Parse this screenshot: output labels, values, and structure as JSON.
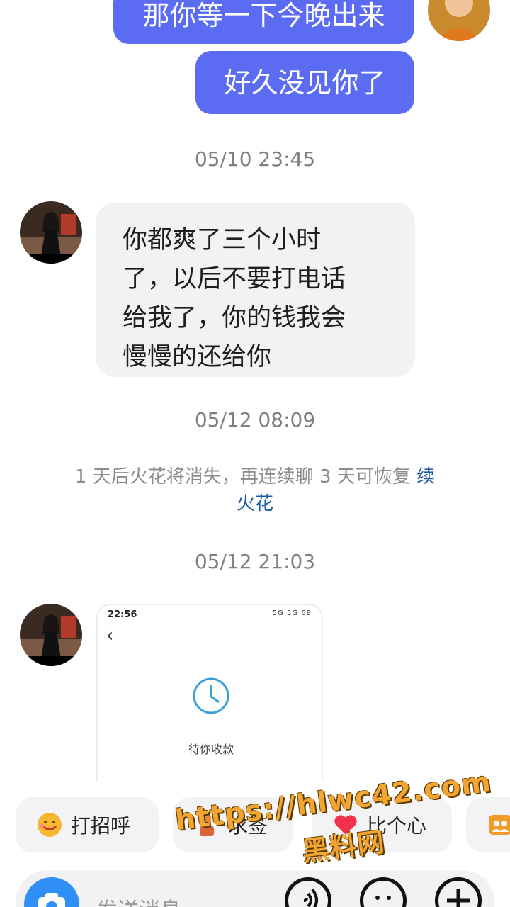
{
  "messages": {
    "out_1": "那你等一下今晚出来",
    "out_2": "好久没见你了",
    "time_1": "05/10 23:45",
    "in_1": [
      "你都爽了三个小时",
      "了，以后不要打电话",
      "给我了，你的钱我会",
      "慢慢的还给你"
    ],
    "time_2": "05/12 08:09",
    "hint_text": "1 天后火花将消失，再连续聊 3 天可恢复",
    "hint_link": "续火花",
    "time_3": "05/12 21:03",
    "screenshot": {
      "status_time": "22:56",
      "status_right": "5G 5G 68",
      "caption": "待你收款"
    }
  },
  "quick_replies": [
    {
      "label": "打招呼",
      "icon": "smile-emoji-icon"
    },
    {
      "label": "求签",
      "icon": "fortune-icon"
    },
    {
      "label": "比个心",
      "icon": "heart-icon"
    },
    {
      "label": "",
      "icon": "group-icon"
    }
  ],
  "watermark": {
    "line1": "https://hlwc42.com",
    "line2": "黑料网"
  },
  "composer": {
    "placeholder": "发送消息"
  },
  "colors": {
    "outgoing_bubble": "#5b6cf2",
    "incoming_bubble": "#f2f2f2",
    "link": "#1e5aa6",
    "camera_button": "#2f8ff5"
  }
}
